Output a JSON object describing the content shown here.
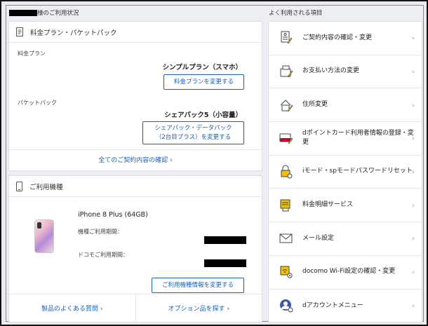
{
  "header": {
    "left_title": "様のご利用状況",
    "right_title": "よく利用される項目"
  },
  "plan_card": {
    "title": "料金プラン・パケットパック",
    "plan_label": "料金プラン",
    "plan_value": "シンプルプラン（スマホ）",
    "plan_button": "料金プランを変更する",
    "packet_label": "パケットパック",
    "packet_value": "シェアパック5（小容量）",
    "packet_button_line1": "シェアパック・データパック",
    "packet_button_line2": "（2台目プラス）を変更する",
    "all_link": "全てのご契約内容の確認 ›"
  },
  "device_card": {
    "title": "ご利用機種",
    "model": "iPhone 8 Plus (64GB)",
    "device_period_label": "機種ご利用期間：",
    "docomo_period_label": "ドコモご利用期間：",
    "change_button": "ご利用機種情報を変更する",
    "faq_link": "製品のよくある質問 ›",
    "option_link": "オプション品を探す ›"
  },
  "menu": [
    {
      "label": "ご契約内容の確認・変更",
      "icon": "contract-doc-icon"
    },
    {
      "label": "お支払い方法の変更",
      "icon": "wallet-icon"
    },
    {
      "label": "住所変更",
      "icon": "house-icon"
    },
    {
      "label": "dポイントカード利用者情報の登録・変更",
      "icon": "dpoint-card-icon"
    },
    {
      "label": "iモード・spモードパスワードリセット",
      "icon": "lock-icon"
    },
    {
      "label": "料金明細サービス",
      "icon": "bill-icon"
    },
    {
      "label": "メール設定",
      "icon": "mail-icon"
    },
    {
      "label": "docomo Wi-Fi設定の確認・変更",
      "icon": "wifi-settings-icon"
    },
    {
      "label": "dアカウントメニュー",
      "icon": "daccount-icon"
    }
  ],
  "colors": {
    "accent": "#1a5fb4",
    "background": "#eceef2"
  }
}
